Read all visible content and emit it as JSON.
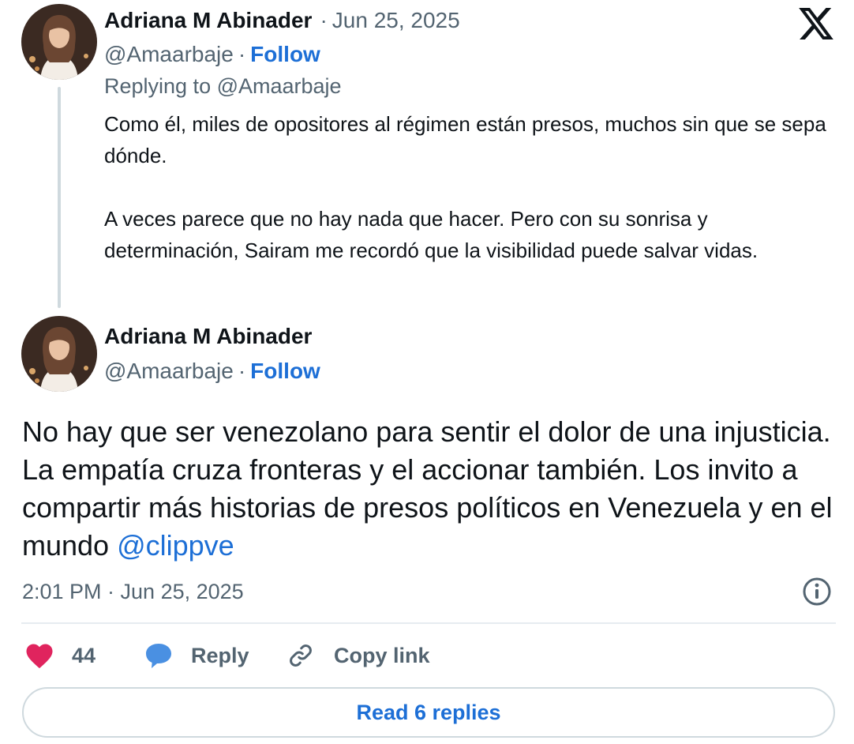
{
  "reply_tweet": {
    "author_name": "Adriana M Abinader",
    "date": "Jun 25, 2025",
    "handle": "@Amaarbaje",
    "follow_label": "Follow",
    "replying_to": "Replying to @Amaarbaje",
    "paragraphs": [
      "Como él, miles de opositores al régimen están presos, muchos sin que se sepa dónde.",
      "A veces parece que no hay nada que hacer. Pero con su sonrisa y determinación, Sairam me recordó que la visibilidad puede salvar vidas."
    ]
  },
  "main_tweet": {
    "author_name": "Adriana M Abinader",
    "handle": "@Amaarbaje",
    "follow_label": "Follow",
    "text": "No hay que ser venezolano para sentir el dolor de una injusticia. La empatía cruza fronteras y el accionar también. Los invito a compartir más historias de presos políticos en Venezuela y en el mundo",
    "mention": "@clippve",
    "timestamp": "2:01 PM · Jun 25, 2025"
  },
  "separator": "·",
  "actions": {
    "like_count": "44",
    "reply_label": "Reply",
    "copy_link_label": "Copy link"
  },
  "read_replies_label": "Read 6 replies",
  "icons": {
    "brand": "x-logo-icon",
    "info": "info-icon",
    "like": "heart-icon",
    "reply": "speech-bubble-icon",
    "copy": "link-icon"
  },
  "colors": {
    "link": "#1d6fd6",
    "heart": "#e0245e",
    "reply_bubble": "#4a90e2",
    "muted": "#536471"
  }
}
